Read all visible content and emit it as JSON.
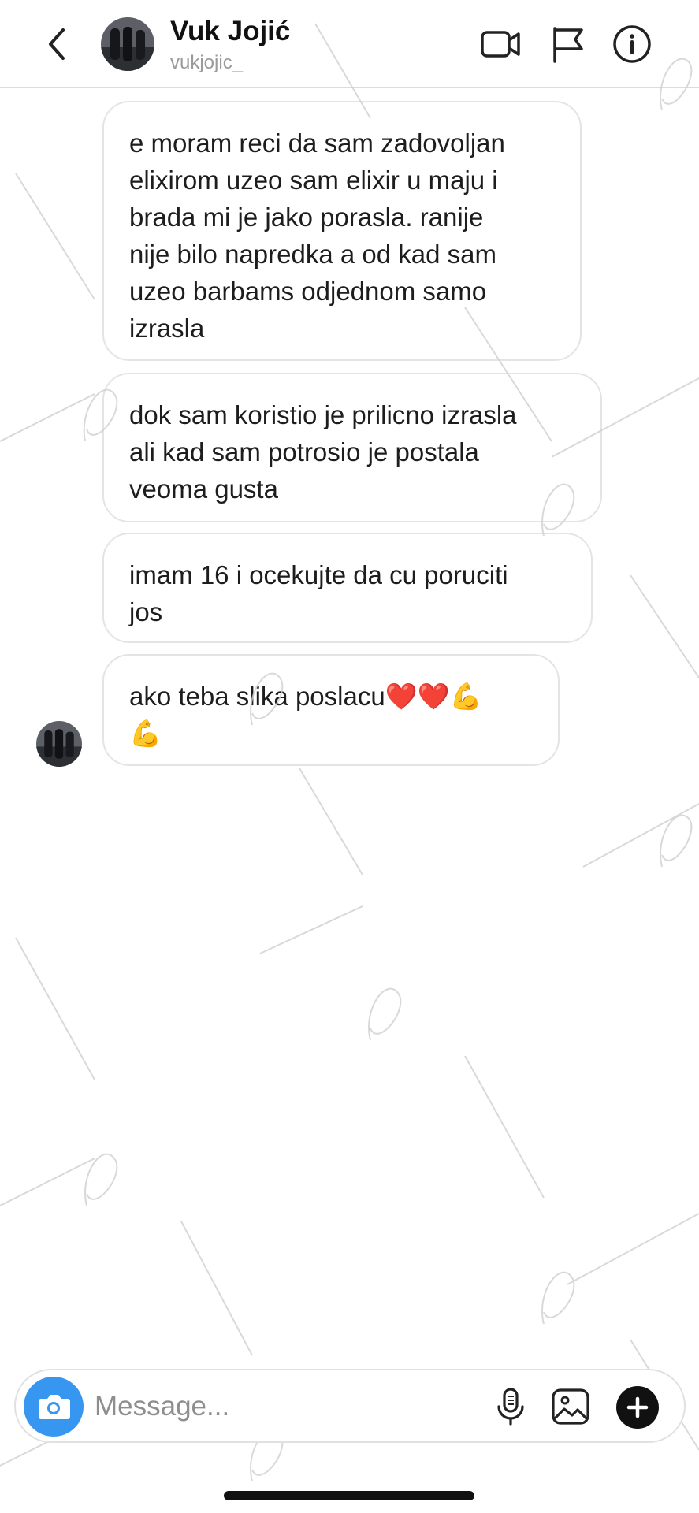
{
  "header": {
    "name": "Vuk Jojić",
    "username": "vukjojic_"
  },
  "messages": [
    {
      "text": "e moram reci da sam zadovoljan\nelixirom uzeo sam elixir u maju i\nbrada mi je jako porasla. ranije\nnije bilo napredka a od kad sam\nuzeo barbams odjednom samo\nizrasla"
    },
    {
      "text": "dok sam koristio je prilicno izrasla\nali kad sam potrosio je postala\nveoma gusta"
    },
    {
      "text": "imam 16 i ocekujte da cu poruciti\njos"
    },
    {
      "text": "ako teba slika poslacu❤️❤️💪\n💪"
    }
  ],
  "composer": {
    "placeholder": "Message..."
  },
  "icons": {
    "back": "chevron-left-icon",
    "video": "video-camera-icon",
    "flag": "flag-icon",
    "info": "info-icon",
    "camera": "camera-icon",
    "mic": "microphone-icon",
    "gallery": "gallery-icon",
    "plus": "plus-icon"
  },
  "colors": {
    "accent": "#3797f0",
    "bubble_border": "#e4e4e4",
    "watermark": "#cfcfcf"
  }
}
